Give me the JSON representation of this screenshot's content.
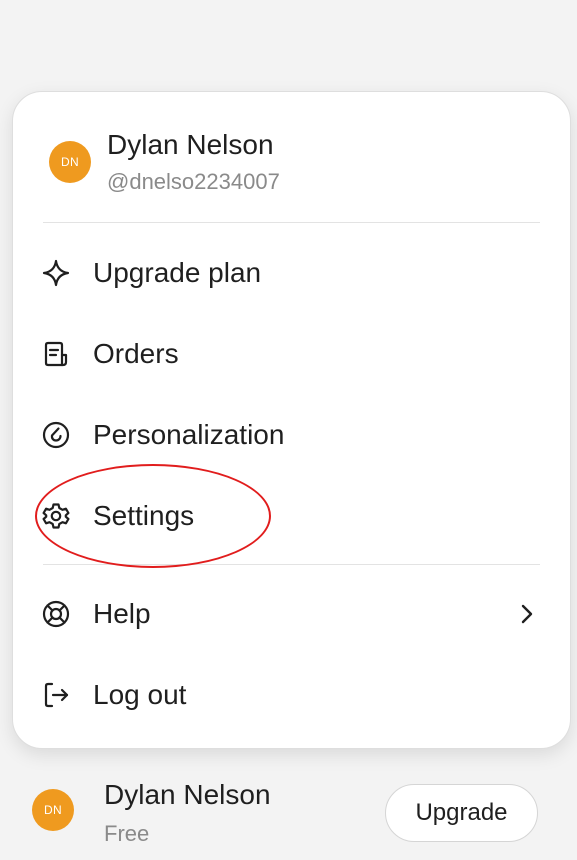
{
  "profile": {
    "initials": "DN",
    "name": "Dylan Nelson",
    "handle": "@dnelso2234007"
  },
  "menu": {
    "upgrade_plan": "Upgrade plan",
    "orders": "Orders",
    "personalization": "Personalization",
    "settings": "Settings",
    "help": "Help",
    "log_out": "Log out"
  },
  "icons": {
    "upgrade_plan": "sparkle-icon",
    "orders": "receipt-icon",
    "personalization": "personalization-icon",
    "settings": "gear-icon",
    "help": "lifebuoy-icon",
    "help_chevron": "chevron-right-icon",
    "log_out": "logout-icon"
  },
  "footer": {
    "initials": "DN",
    "name": "Dylan Nelson",
    "plan": "Free",
    "upgrade_label": "Upgrade"
  },
  "colors": {
    "avatar": "#ef9a1f",
    "highlight": "#e11d1d",
    "text": "#1f1f1f",
    "muted": "#8a8a8a"
  }
}
